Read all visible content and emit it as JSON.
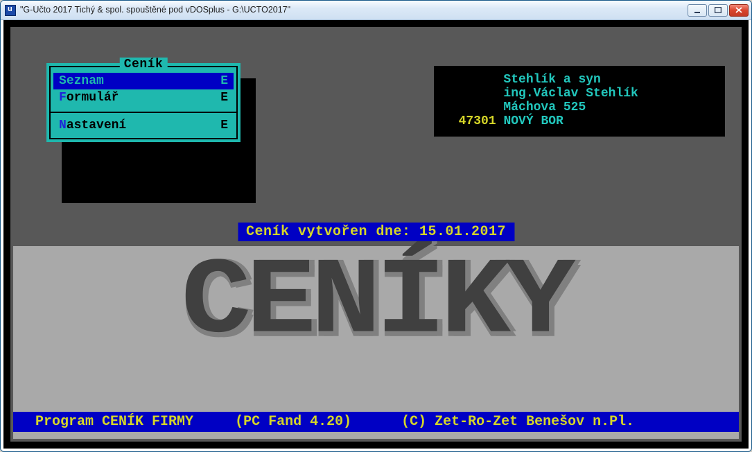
{
  "window": {
    "title": "\"G-Účto 2017 Tichý & spol. spouštěné pod vDOSplus - G:\\UCTO2017\""
  },
  "menu": {
    "title": "Ceník",
    "items": [
      {
        "label": "Seznam",
        "hotkey": "S",
        "rest": "eznam",
        "shortcut": "E",
        "selected": true
      },
      {
        "label": "Formulář",
        "hotkey": "F",
        "rest": "ormulář",
        "shortcut": "E",
        "selected": false
      }
    ],
    "items2": [
      {
        "label": "Nastavení",
        "hotkey": "N",
        "rest": "astavení",
        "shortcut": "E",
        "selected": false
      }
    ]
  },
  "company": {
    "line1": "Stehlík a syn",
    "line2": "ing.Václav Stehlík",
    "line3": "Máchova 525",
    "zip": "47301",
    "city": "NOVÝ BOR"
  },
  "date_banner": "Ceník vytvořen dne: 15.01.2017",
  "big_title": "CENÍKY",
  "footer": {
    "program": "Program CENÍK FIRMY",
    "engine": "(PC Fand 4.20)",
    "copyright": "(C) Zet-Ro-Zet Benešov n.Pl."
  }
}
